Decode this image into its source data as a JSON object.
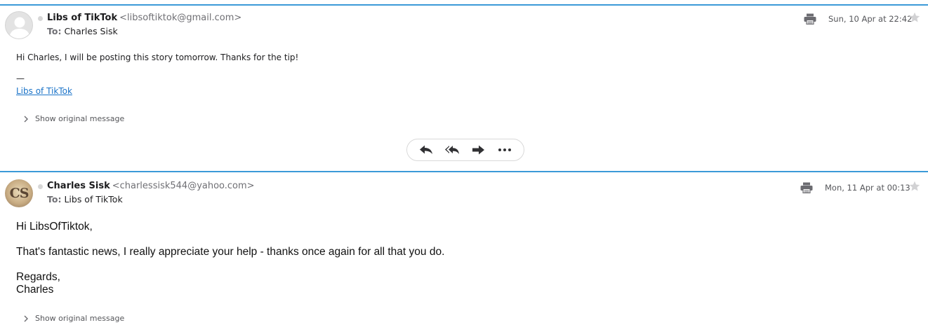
{
  "messages": [
    {
      "sender_name": "Libs of TikTok",
      "sender_email": "<libsoftiktok@gmail.com>",
      "to_label": "To:",
      "to_name": "Charles Sisk",
      "date": "Sun, 10 Apr at 22:42",
      "body_text": "Hi Charles, I will be posting this story tomorrow. Thanks for the tip!",
      "signature_dash": "—",
      "signature_link": "Libs of TikTok",
      "show_original": "Show original message",
      "avatar": "default-person-icon",
      "icons": [
        "print-icon",
        "star-icon",
        "chevron-right-icon"
      ]
    },
    {
      "sender_name": "Charles Sisk",
      "sender_email": "<charlessisk544@yahoo.com>",
      "to_label": "To:",
      "to_name": "Libs of TikTok",
      "date": "Mon, 11 Apr at 00:13",
      "avatar_initials": "CS",
      "greeting": "Hi LibsOfTiktok,",
      "paragraph": "That's fantastic news, I really appreciate your help - thanks once again for all that you do.",
      "regards": "Regards,",
      "signoff": "Charles",
      "show_original": "Show original message",
      "icons": [
        "print-icon",
        "star-icon",
        "chevron-right-icon"
      ]
    }
  ],
  "action_bar": {
    "buttons": [
      "reply-icon",
      "reply-all-icon",
      "forward-icon",
      "more-icon"
    ]
  },
  "colors": {
    "accent_border": "#3b9ad8",
    "link": "#1a73c8",
    "secondary_text": "#6f6f74"
  }
}
